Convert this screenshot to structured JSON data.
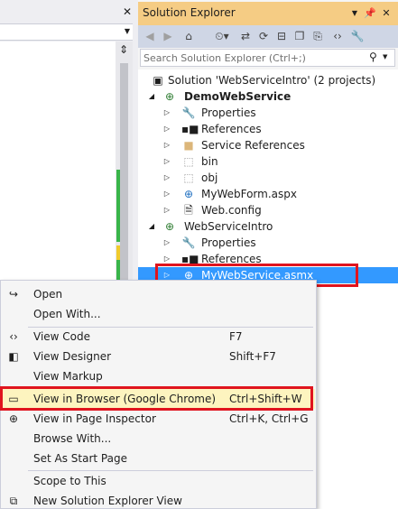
{
  "solution_explorer": {
    "title": "Solution Explorer",
    "search_placeholder": "Search Solution Explorer (Ctrl+;)"
  },
  "tree": {
    "solution": "Solution 'WebServiceIntro' (2 projects)",
    "project1": "DemoWebService",
    "p1_items": [
      "Properties",
      "References",
      "Service References",
      "bin",
      "obj",
      "MyWebForm.aspx",
      "Web.config"
    ],
    "project2": "WebServiceIntro",
    "p2_items": [
      "Properties",
      "References"
    ],
    "selected": "MyWebService.asmx"
  },
  "context_menu": {
    "items": [
      {
        "label": "Open",
        "shortcut": ""
      },
      {
        "label": "Open With...",
        "shortcut": ""
      },
      {
        "label": "View Code",
        "shortcut": "F7"
      },
      {
        "label": "View Designer",
        "shortcut": "Shift+F7"
      },
      {
        "label": "View Markup",
        "shortcut": ""
      },
      {
        "label": "View in Browser (Google Chrome)",
        "shortcut": "Ctrl+Shift+W"
      },
      {
        "label": "View in Page Inspector",
        "shortcut": "Ctrl+K, Ctrl+G"
      },
      {
        "label": "Browse With...",
        "shortcut": ""
      },
      {
        "label": "Set As Start Page",
        "shortcut": ""
      },
      {
        "label": "Scope to This",
        "shortcut": ""
      },
      {
        "label": "New Solution Explorer View",
        "shortcut": ""
      }
    ]
  },
  "colors": {
    "titlebar": "#f5cc84",
    "selection": "#3399ff",
    "menu_highlight": "#fdf4bf",
    "callout_red": "#e0141e"
  }
}
